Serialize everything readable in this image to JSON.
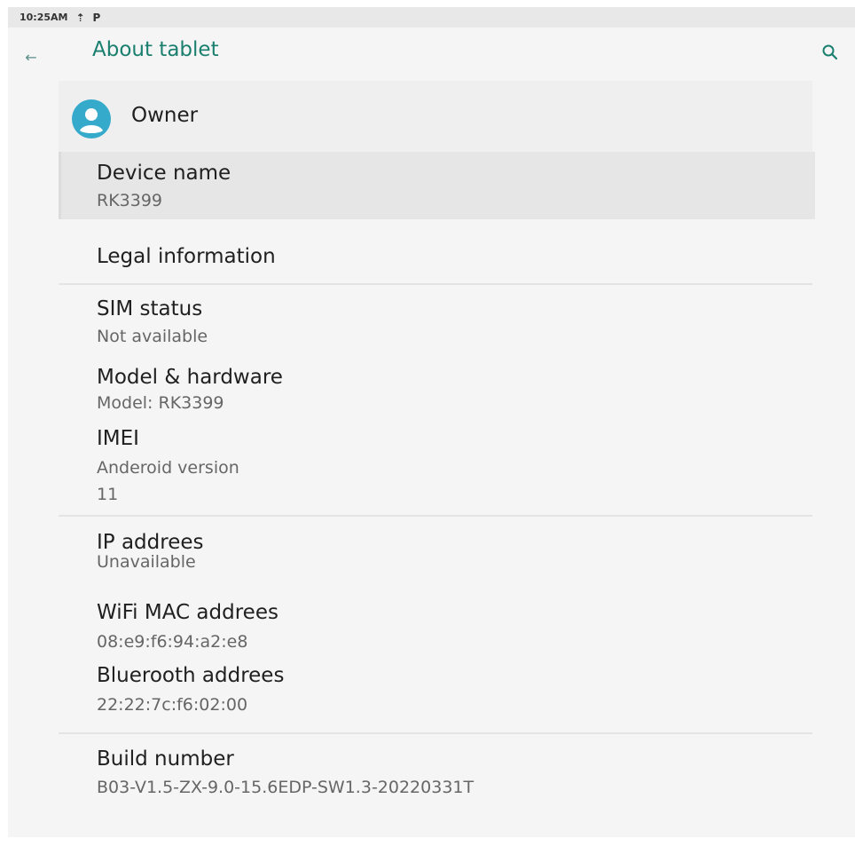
{
  "status_bar": {
    "time": "10:25AM",
    "icons": [
      "upload-icon",
      "parking-icon"
    ]
  },
  "app_bar": {
    "title": "About tablet",
    "back_icon": "back-arrow-icon",
    "search_icon": "search-icon"
  },
  "owner": {
    "label": "Owner",
    "icon": "account-circle-icon"
  },
  "items": [
    {
      "title": "Device name",
      "subtitle": "RK3399"
    },
    {
      "title": "Legal information"
    },
    {
      "title": "SIM status",
      "subtitle": "Not available"
    },
    {
      "title": "Model & hardware",
      "subtitle": "Model: RK3399"
    },
    {
      "title": "IMEI",
      "subtitle": "Anderoid version"
    },
    {
      "title": "11"
    },
    {
      "title": "IP addrees",
      "subtitle": "Unavailable"
    },
    {
      "title": "WiFi MAC addrees",
      "subtitle": "08:e9:f6:94:a2:e8"
    },
    {
      "title": "Bluerooth addrees",
      "subtitle": "22:22:7c:f6:02:00"
    },
    {
      "title": "Build number",
      "subtitle": "B03-V1.5-ZX-9.0-15.6EDP-SW1.3-20220331T"
    }
  ],
  "colors": {
    "accent": "#1a7f6e",
    "avatar": "#36aacb",
    "background": "#f5f5f5"
  }
}
